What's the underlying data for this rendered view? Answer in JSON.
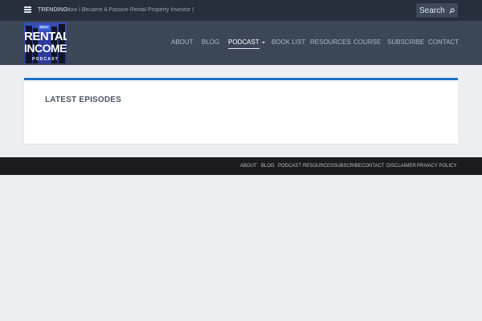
{
  "topbar": {
    "trending_label": "TRENDING:",
    "trending_link": "How I Became A Passive Rental Property Investor (With T...",
    "search_placeholder": "Search"
  },
  "logo": {
    "rent": "RENT",
    "line1": "RENTAL",
    "line2": "INCOME",
    "line3": "PODCAST"
  },
  "nav": {
    "items": [
      {
        "label": "ABOUT"
      },
      {
        "label": "BLOG"
      },
      {
        "label": "PODCAST",
        "active": true
      },
      {
        "label": "BOOK LIST"
      },
      {
        "label": "RESOURCES"
      },
      {
        "label": "COURSE"
      },
      {
        "label": "SUBSCRIBE"
      },
      {
        "label": "CONTACT"
      }
    ]
  },
  "main": {
    "title": "LATEST EPISODES"
  },
  "footer": {
    "links": [
      "ABOUT",
      "BLOG",
      "PODCAST",
      "RESOURCES",
      "SUBSCRIBE",
      "CONTACT",
      "DISCLAIMER",
      "PRIVACY POLICY"
    ]
  },
  "colors": {
    "accent": "#1e6fc9",
    "topbar": "#262f3b",
    "header": "#3a4556",
    "footer": "#1c1c1e",
    "background": "#eceef2"
  }
}
